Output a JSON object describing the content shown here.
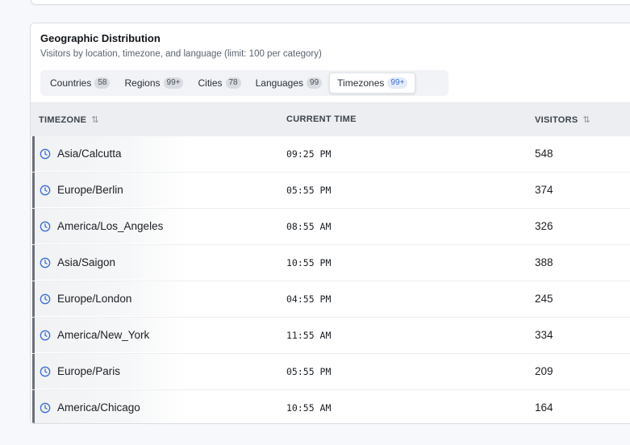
{
  "header": {
    "title": "Geographic Distribution",
    "subtitle": "Visitors by location, timezone, and language (limit: 100 per category)"
  },
  "tabs": [
    {
      "label": "Countries",
      "count": "58"
    },
    {
      "label": "Regions",
      "count": "99+"
    },
    {
      "label": "Cities",
      "count": "78"
    },
    {
      "label": "Languages",
      "count": "99"
    },
    {
      "label": "Timezones",
      "count": "99+",
      "active": true
    }
  ],
  "table": {
    "columns": [
      "TIMEZONE",
      "CURRENT TIME",
      "VISITORS"
    ],
    "sort_icon": "⇅",
    "rows": [
      {
        "timezone": "Asia/Calcutta",
        "time": "09:25 PM",
        "visitors": "548"
      },
      {
        "timezone": "Europe/Berlin",
        "time": "05:55 PM",
        "visitors": "374"
      },
      {
        "timezone": "America/Los_Angeles",
        "time": "08:55 AM",
        "visitors": "326"
      },
      {
        "timezone": "Asia/Saigon",
        "time": "10:55 PM",
        "visitors": "388"
      },
      {
        "timezone": "Europe/London",
        "time": "04:55 PM",
        "visitors": "245"
      },
      {
        "timezone": "America/New_York",
        "time": "11:55 AM",
        "visitors": "334"
      },
      {
        "timezone": "Europe/Paris",
        "time": "05:55 PM",
        "visitors": "209"
      },
      {
        "timezone": "America/Chicago",
        "time": "10:55 AM",
        "visitors": "164"
      }
    ]
  },
  "colors": {
    "accent": "#3b6fd8",
    "row_marker": "#6b7078"
  },
  "icons": {
    "row_icon": "clock-icon"
  }
}
